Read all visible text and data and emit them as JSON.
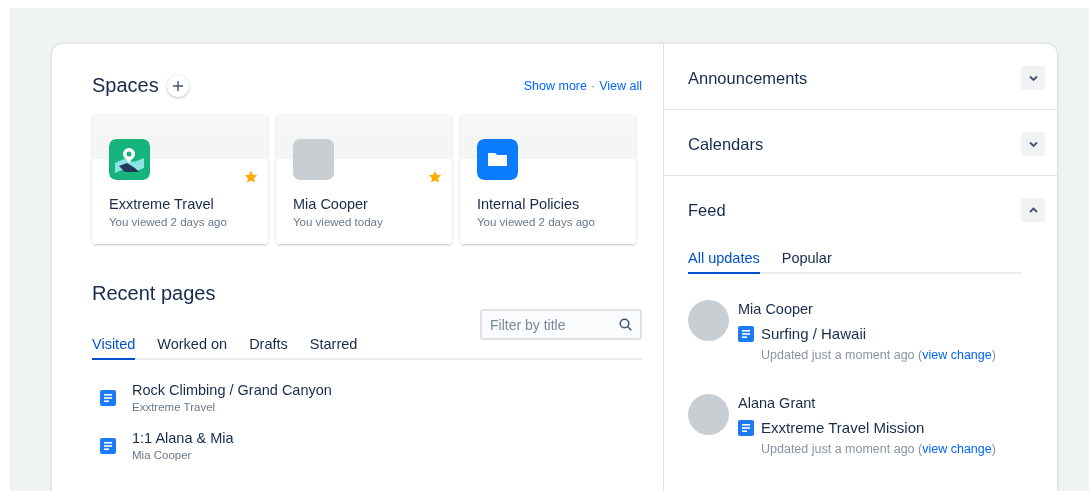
{
  "spaces": {
    "title": "Spaces",
    "links": [
      {
        "label": "Show more"
      },
      {
        "label": "View all"
      }
    ],
    "separator": "·",
    "cards": [
      {
        "kind": "map-app",
        "name": "Exxtreme Travel",
        "meta": "You viewed 2 days ago",
        "starred": true
      },
      {
        "kind": "photo",
        "name": "Mia Cooper",
        "meta": "You viewed today",
        "starred": true
      },
      {
        "kind": "folder",
        "name": "Internal Policies",
        "meta": "You viewed 2 days ago",
        "starred": false
      }
    ]
  },
  "recent_pages": {
    "title": "Recent pages",
    "tabs": [
      {
        "label": "Visited",
        "selected": true
      },
      {
        "label": "Worked on",
        "selected": false
      },
      {
        "label": "Drafts",
        "selected": false
      },
      {
        "label": "Starred",
        "selected": false
      }
    ],
    "filter": {
      "placeholder": "Filter by title"
    },
    "pages": [
      {
        "title": "Rock Climbing / Grand Canyon",
        "space": "Exxtreme Travel"
      },
      {
        "title": "1:1 Alana & Mia",
        "space": "Mia Cooper"
      }
    ]
  },
  "panels": [
    {
      "title": "Announcements",
      "expanded": false
    },
    {
      "title": "Calendars",
      "expanded": false
    },
    {
      "title": "Feed",
      "expanded": true,
      "tabs": [
        {
          "label": "All updates",
          "selected": true
        },
        {
          "label": "Popular",
          "selected": false
        }
      ],
      "items": [
        {
          "author": "Mia Cooper",
          "page": "Surfing / Hawaii",
          "before": "Updated just a moment ago (",
          "link": "view change",
          "after": ")"
        },
        {
          "author": "Alana Grant",
          "page": "Exxtreme Travel Mission",
          "before": "Updated just a moment ago (",
          "link": "view change",
          "after": ")"
        }
      ]
    }
  ]
}
